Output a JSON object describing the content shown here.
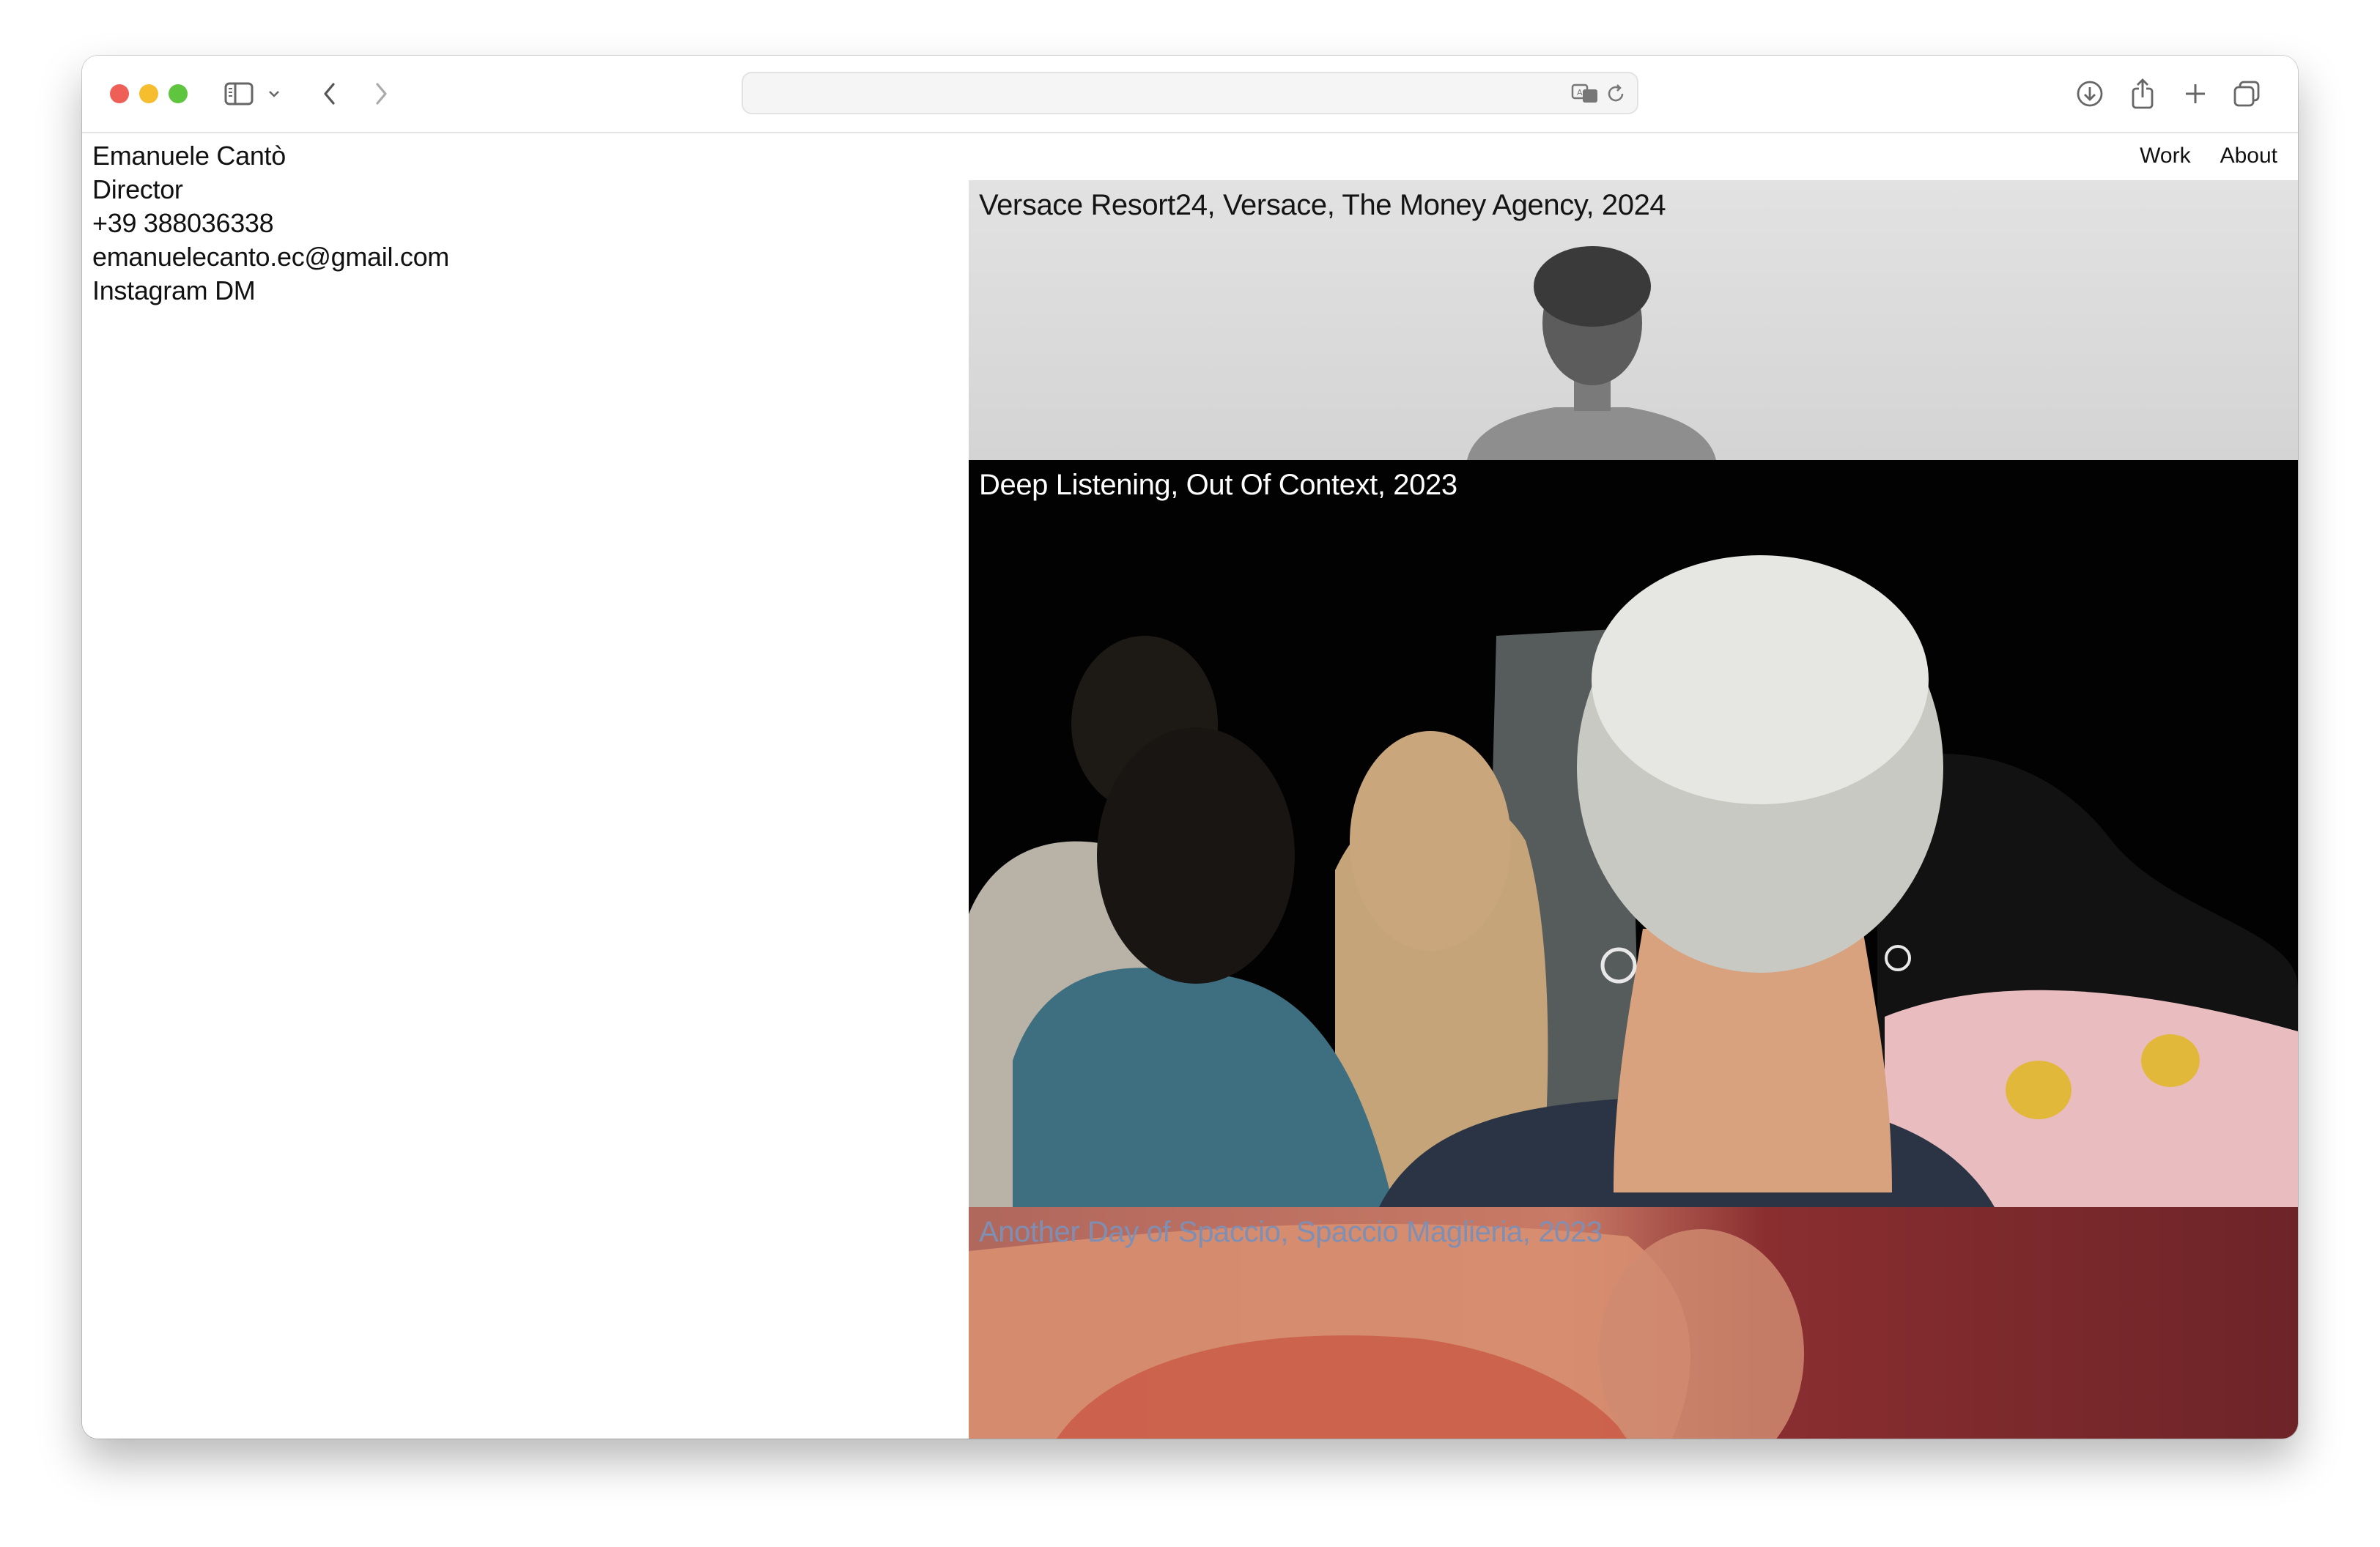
{
  "browser": {
    "url": "",
    "icons": [
      "sidebar-icon",
      "chevron-down-icon",
      "back-icon",
      "forward-icon",
      "translate-icon",
      "reload-icon",
      "download-icon",
      "share-icon",
      "new-tab-icon",
      "tabs-overview-icon"
    ]
  },
  "profile": {
    "name": "Emanuele Cantò",
    "role": "Director",
    "phone": "+39 388036338",
    "email": "emanuelecanto.ec@gmail.com",
    "instagram": "Instagram DM"
  },
  "nav": {
    "work": "Work",
    "about": "About"
  },
  "projects": [
    {
      "title": "Versace Resort24, Versace, The Money Agency, 2024",
      "title_color": "#141414"
    },
    {
      "title": "Deep Listening, Out Of Context, 2023",
      "title_color": "#ffffff"
    },
    {
      "title": "Another Day of Spaccio, Spaccio Maglieria, 2023",
      "title_color": "#7f8fb4"
    }
  ],
  "colors": {
    "close": "#ee5f57",
    "minimize": "#f6bd2f",
    "maximize": "#5fc53e"
  }
}
